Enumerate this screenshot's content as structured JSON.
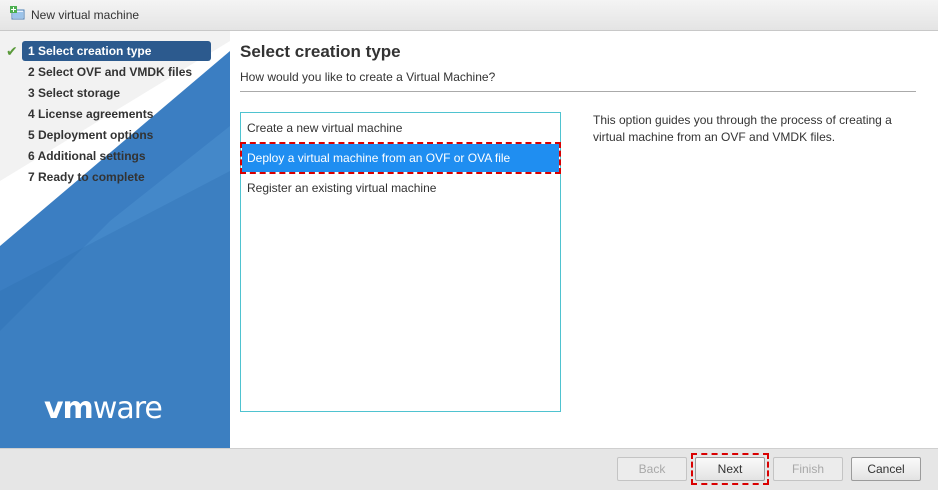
{
  "window": {
    "title": "New virtual machine",
    "icon": "new-vm-icon"
  },
  "sidebar": {
    "steps": [
      {
        "label": "1 Select creation type",
        "state": "active",
        "completed": true
      },
      {
        "label": "2 Select OVF and VMDK files",
        "state": "pending"
      },
      {
        "label": "3 Select storage",
        "state": "pending"
      },
      {
        "label": "4 License agreements",
        "state": "pending"
      },
      {
        "label": "5 Deployment options",
        "state": "pending"
      },
      {
        "label": "6 Additional settings",
        "state": "pending"
      },
      {
        "label": "7 Ready to complete",
        "state": "pending"
      }
    ],
    "logo": {
      "vm": "vm",
      "ware": "ware"
    },
    "colors": {
      "background": "#3b7ec2",
      "active_step": "#2c5a8e",
      "check": "#5a9a3a"
    }
  },
  "main": {
    "title": "Select creation type",
    "subtitle": "How would you like to create a Virtual Machine?",
    "options": [
      {
        "label": "Create a new virtual machine",
        "selected": false
      },
      {
        "label": "Deploy a virtual machine from an OVF or OVA file",
        "selected": true
      },
      {
        "label": "Register an existing virtual machine",
        "selected": false
      }
    ],
    "description": "This option guides you through the process of creating a virtual machine from an OVF and VMDK files.",
    "colors": {
      "selected": "#1f8ef1",
      "list_border": "#4fc3d0",
      "highlight_outline": "#d90000"
    }
  },
  "footer": {
    "back_label": "Back",
    "next_label": "Next",
    "finish_label": "Finish",
    "cancel_label": "Cancel"
  }
}
